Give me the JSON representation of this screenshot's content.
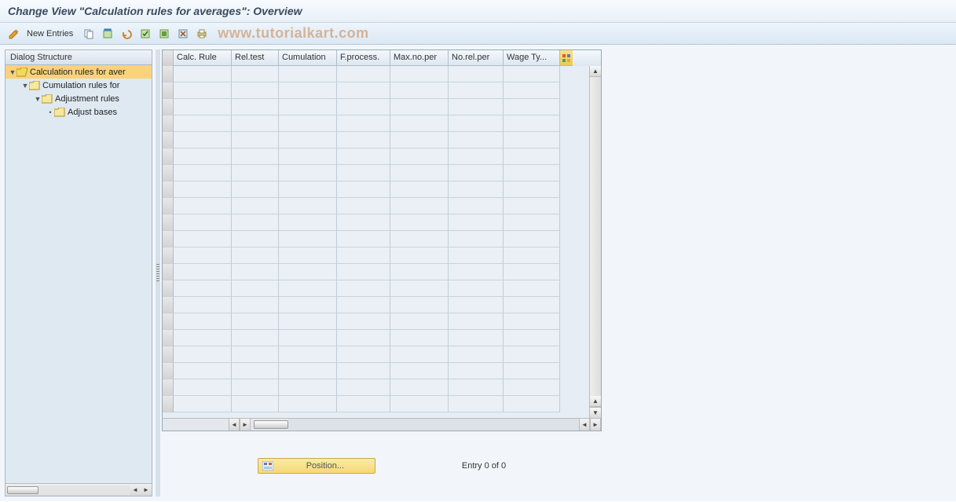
{
  "title": "Change View \"Calculation rules for averages\": Overview",
  "toolbar": {
    "new_entries_label": "New Entries"
  },
  "watermark": "www.tutorialkart.com",
  "dialog_structure": {
    "header": "Dialog Structure",
    "nodes": [
      {
        "label": "Calculation rules for aver",
        "level": 0,
        "open": true,
        "selected": true
      },
      {
        "label": "Cumulation rules for",
        "level": 1,
        "open": false,
        "selected": false
      },
      {
        "label": "Adjustment rules",
        "level": 2,
        "open": false,
        "selected": false
      },
      {
        "label": "Adjust bases",
        "level": 3,
        "open": false,
        "selected": false
      }
    ]
  },
  "table": {
    "columns": [
      "Calc. Rule",
      "Rel.test",
      "Cumulation",
      "F.process.",
      "Max.no.per",
      "No.rel.per",
      "Wage Ty..."
    ],
    "row_count": 21
  },
  "footer": {
    "position_label": "Position...",
    "entry_status": "Entry 0 of 0"
  },
  "colors": {
    "selection": "#f9d27a",
    "panel_bg": "#dfe9f2"
  }
}
